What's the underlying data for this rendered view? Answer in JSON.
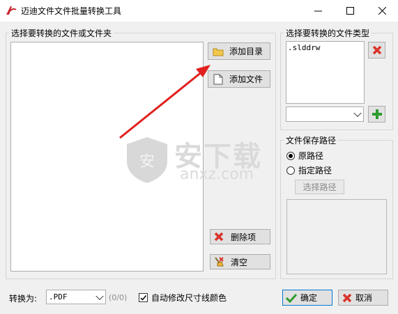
{
  "window": {
    "title": "迈迪文件文件批量转换工具"
  },
  "left_group": {
    "legend": "选择要转换的文件或文件夹"
  },
  "buttons": {
    "add_dir": "添加目录",
    "add_file": "添加文件",
    "delete_item": "删除项",
    "clear": "清空",
    "choose_path": "选择路径",
    "ok": "确定",
    "cancel": "取消"
  },
  "type_group": {
    "legend": "选择要转换的文件类型",
    "items": [
      ".slddrw"
    ],
    "new_type_value": ""
  },
  "save_group": {
    "legend": "文件保存路径",
    "options": [
      "原路径",
      "指定路径"
    ],
    "selected": "原路径"
  },
  "bottom": {
    "convert_label": "转换为:",
    "format_value": ".PDF",
    "count": "(0/0)",
    "auto_modify_label": "自动修改尺寸线颜色",
    "auto_modify_checked": true
  },
  "watermark": {
    "text": "安下载",
    "subtext": "anxz.com"
  },
  "colors": {
    "arrow": "#e0201e",
    "delete_icon": "#d9342b",
    "add_icon": "#2e9b2e",
    "titlebar": "#ffffff"
  }
}
